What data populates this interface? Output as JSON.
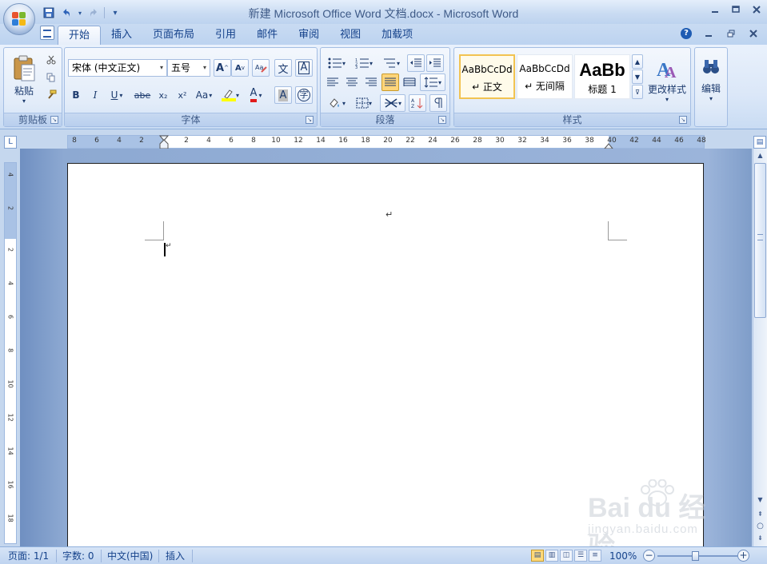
{
  "window": {
    "title": "新建 Microsoft Office Word 文档.docx - Microsoft Word",
    "controls": [
      "_",
      "□",
      "×"
    ]
  },
  "quick_access": [
    {
      "name": "save-icon",
      "glyph": "💾"
    },
    {
      "name": "undo-icon",
      "glyph": "↶"
    },
    {
      "name": "redo-icon",
      "glyph": "↷"
    },
    {
      "name": "customize-qat-icon",
      "glyph": "▾"
    }
  ],
  "tabs": [
    "开始",
    "插入",
    "页面布局",
    "引用",
    "邮件",
    "审阅",
    "视图",
    "加载项"
  ],
  "active_tab": "开始",
  "ribbon": {
    "clipboard": {
      "label": "剪贴板",
      "paste": "粘贴"
    },
    "font": {
      "label": "字体",
      "font_name": "宋体 (中文正文)",
      "font_size": "五号",
      "bold": "B",
      "italic": "I",
      "underline": "U",
      "strike": "abe",
      "subscript": "x₂",
      "superscript": "x²",
      "case": "Aa",
      "grow": "A",
      "shrink": "A",
      "phonetic": "文",
      "border_char": "A",
      "enclose": "字",
      "font_color_sample": "A",
      "char_shading": "A"
    },
    "paragraph": {
      "label": "段落"
    },
    "styles": {
      "label": "样式",
      "items": [
        {
          "sample": "AaBbCcDd",
          "name": "↵ 正文"
        },
        {
          "sample": "AaBbCcDd",
          "name": "↵ 无间隔"
        },
        {
          "sample": "AaBb",
          "name": "标题 1"
        }
      ],
      "change_styles": "更改样式"
    },
    "editing": {
      "label": "编辑"
    }
  },
  "ruler": {
    "h_ticks": [
      "8",
      "6",
      "4",
      "2",
      "2",
      "4",
      "6",
      "8",
      "10",
      "12",
      "14",
      "16",
      "18",
      "20",
      "22",
      "24",
      "26",
      "28",
      "30",
      "32",
      "34",
      "36",
      "38",
      "40",
      "42",
      "44",
      "46",
      "48"
    ],
    "v_ticks": [
      "4",
      "2",
      "2",
      "4",
      "6",
      "8",
      "10",
      "12",
      "14",
      "16",
      "18"
    ]
  },
  "document": {
    "paragraph_mark": "↵",
    "cursor_mark": "↵"
  },
  "status": {
    "page": "页面: 1/1",
    "words": "字数: 0",
    "language": "中文(中国)",
    "mode": "插入",
    "zoom": "100%",
    "zoom_level": 1.0
  },
  "watermark": {
    "brand": "Bai du 经验",
    "url": "jingyan.baidu.com"
  },
  "colors": {
    "accent": "#15428b",
    "ribbon_bg": "#dbe7f8",
    "selected_style_border": "#f2c351"
  }
}
